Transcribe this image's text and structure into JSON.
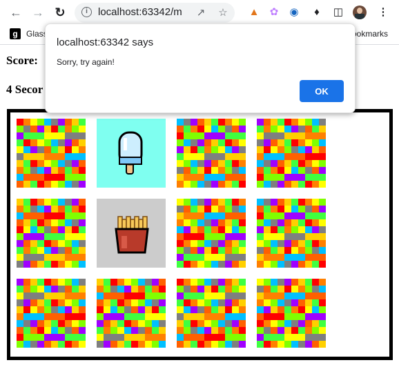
{
  "browser": {
    "url": "localhost:63342/m",
    "bookmark_label": "Glass",
    "bookmark_favicon": "g",
    "bookmarks_right": "ookmarks"
  },
  "page": {
    "score_label": "Score:",
    "timer_label": "4 Secor"
  },
  "dialog": {
    "title": "localhost:63342 says",
    "message": "Sorry, try again!",
    "ok_label": "OK"
  },
  "board": {
    "rows": 3,
    "cols": 4,
    "cards": [
      {
        "state": "hidden"
      },
      {
        "state": "revealed",
        "image": "ice-pop",
        "background": "#7ffff0"
      },
      {
        "state": "hidden"
      },
      {
        "state": "hidden"
      },
      {
        "state": "hidden"
      },
      {
        "state": "revealed",
        "image": "french-fries",
        "background": "#cccccc"
      },
      {
        "state": "hidden"
      },
      {
        "state": "hidden"
      },
      {
        "state": "hidden"
      },
      {
        "state": "hidden"
      },
      {
        "state": "hidden"
      },
      {
        "state": "hidden"
      }
    ],
    "pattern_colors": [
      "#ff0000",
      "#ff8000",
      "#ffff00",
      "#80ff00",
      "#00c0ff",
      "#7f7f7f",
      "#a000ff",
      "#ff6000",
      "#ffd000",
      "#40ff40"
    ]
  },
  "colors": {
    "dialog_button": "#1a73e8",
    "board_border": "#000000"
  }
}
